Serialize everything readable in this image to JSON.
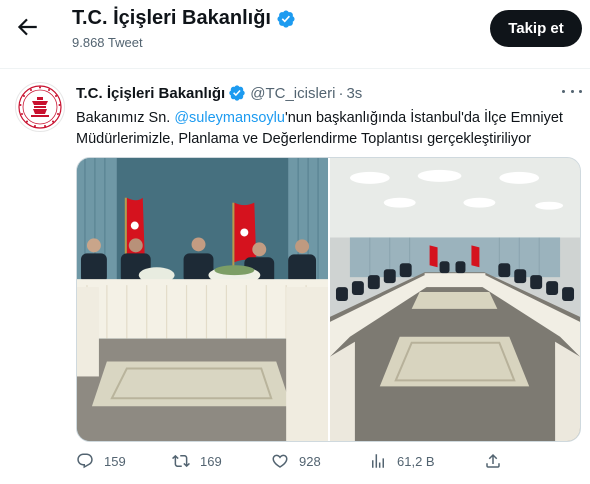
{
  "header": {
    "title": "T.C. İçişleri Bakanlığı",
    "subtitle": "9.868 Tweet",
    "follow_label": "Takip et"
  },
  "tweet": {
    "name": "T.C. İçişleri Bakanlığı",
    "handle": "@TC_icisleri",
    "separator": "·",
    "time": "3s",
    "text_before": "Bakanımız Sn. ",
    "mention": "@suleymansoylu",
    "text_after": "'nun başkanlığında İstanbul'da İlçe Emniyet Müdürlerimizle, Planlama ve Değerlendirme Toplantısı gerçekleştiriliyor"
  },
  "actions": {
    "replies": "159",
    "retweets": "169",
    "likes": "928",
    "views": "61,2 B"
  },
  "colors": {
    "accent": "#1d9bf0",
    "follow_bg": "#0f1419",
    "secondary_text": "#536471",
    "verified": "#1d9bf0"
  },
  "icons": {
    "back": "arrow-left-icon",
    "verified": "verified-badge-icon",
    "more": "more-horizontal-icon",
    "reply": "comment-icon",
    "retweet": "retweet-icon",
    "like": "heart-icon",
    "views": "bar-chart-icon",
    "share": "share-icon"
  }
}
